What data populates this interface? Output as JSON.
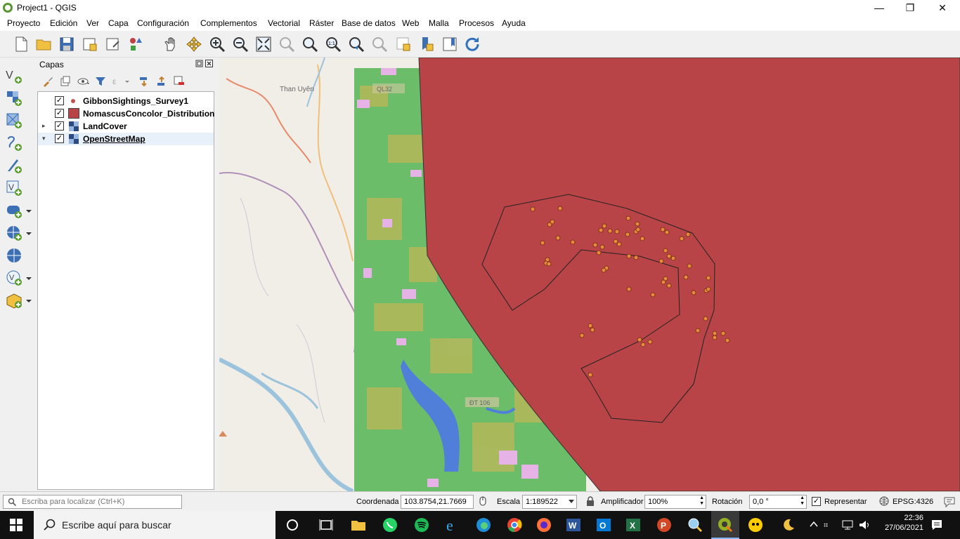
{
  "window": {
    "title": "Project1 - QGIS",
    "minimize": "—",
    "maximize": "❐",
    "close": "✕"
  },
  "menu": [
    "Proyecto",
    "Edición",
    "Ver",
    "Capa",
    "Configuración",
    "Complementos",
    "Vectorial",
    "Ráster",
    "Base de datos",
    "Web",
    "Malla",
    "Procesos",
    "Ayuda"
  ],
  "layers_panel": {
    "title": "Capas",
    "layers": [
      {
        "name": "GibbonSightings_Survey1",
        "checked": true,
        "expandable": false,
        "symbol": "point",
        "color": "#c0504d"
      },
      {
        "name": "NomascusConcolor_Distribution",
        "checked": true,
        "expandable": false,
        "symbol": "polygon",
        "color": "#b84447"
      },
      {
        "name": "LandCover",
        "checked": true,
        "expandable": true,
        "symbol": "raster"
      },
      {
        "name": "OpenStreetMap",
        "checked": true,
        "expandable": true,
        "expanded": true,
        "symbol": "raster"
      }
    ]
  },
  "map": {
    "labels": [
      "Than Uyên",
      "QL32",
      "ĐT 106"
    ],
    "colors": {
      "osm_bg": "#f1eee8",
      "landcover_green": "#6cbd6a",
      "landcover_olive": "#b5b85a",
      "landcover_pink": "#e6b3e6",
      "water": "#4f7fd8",
      "distribution": "#b84447",
      "sightings": "#e8893c"
    }
  },
  "status": {
    "locator_placeholder": "Escriba para localizar (Ctrl+K)",
    "coord_label": "Coordenada",
    "coord_value": "103.8754,21.7669",
    "scale_label": "Escala",
    "scale_value": "1:189522",
    "magnifier_label": "Amplificador",
    "magnifier_value": "100%",
    "rotation_label": "Rotación",
    "rotation_value": "0,0 °",
    "render_label": "Representar",
    "render_checked": true,
    "crs": "EPSG:4326"
  },
  "taskbar": {
    "search_placeholder": "Escribe aquí para buscar",
    "time": "22:36",
    "date": "27/06/2021"
  }
}
